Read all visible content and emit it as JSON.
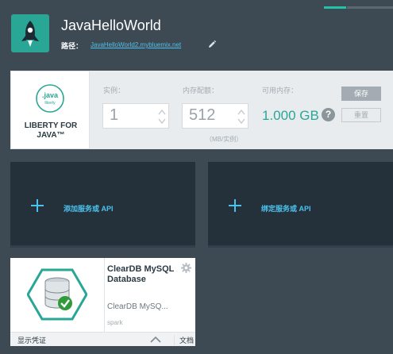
{
  "app": {
    "title": "JavaHelloWorld",
    "route_label": "路径：",
    "route_url": "JavaHelloWorld2.mybluemix.net",
    "icon": "rocket-icon"
  },
  "runtime": {
    "logo_text": ".java",
    "logo_subtext": "liberty",
    "name_line1": "LIBERTY FOR",
    "name_line2": "JAVA™"
  },
  "config": {
    "instances_label": "实例：",
    "instances_value": "1",
    "memory_label": "内存配额：",
    "memory_value": "512",
    "memory_unit": "（MB/实例）",
    "available_label": "可用内存：",
    "available_value": "1.000 GB",
    "help_glyph": "?",
    "save_label": "保存",
    "reset_label": "重置"
  },
  "actions": {
    "add_service": "添加服务或 API",
    "bind_service": "绑定服务或 API"
  },
  "service": {
    "name": "ClearDB MySQL Database",
    "description": "ClearDB MySQ...",
    "plan": "spark",
    "show_credentials": "显示凭证",
    "docs": "文档"
  },
  "colors": {
    "background": "#3e4a53",
    "accent_teal": "#2aa696",
    "link_blue": "#4bc2ee",
    "tile_dark": "#24313a"
  }
}
